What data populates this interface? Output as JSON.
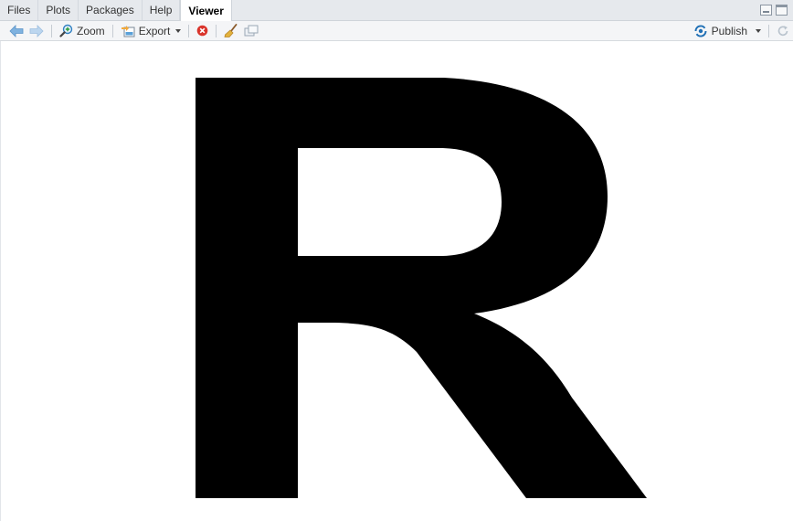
{
  "tabs": [
    {
      "label": "Files",
      "active": false
    },
    {
      "label": "Plots",
      "active": false
    },
    {
      "label": "Packages",
      "active": false
    },
    {
      "label": "Help",
      "active": false
    },
    {
      "label": "Viewer",
      "active": true
    }
  ],
  "toolbar": {
    "back_icon": "arrow-left-icon",
    "forward_icon": "arrow-right-icon",
    "zoom_label": "Zoom",
    "export_label": "Export",
    "remove_icon": "remove-icon",
    "clear_icon": "broom-icon",
    "popout_icon": "show-in-window-icon",
    "publish_label": "Publish",
    "refresh_icon": "refresh-icon"
  },
  "viewer": {
    "glyph": "R",
    "glyph_color": "#000000"
  },
  "colors": {
    "accent": "#1f6fb5",
    "remove": "#d9342b"
  }
}
